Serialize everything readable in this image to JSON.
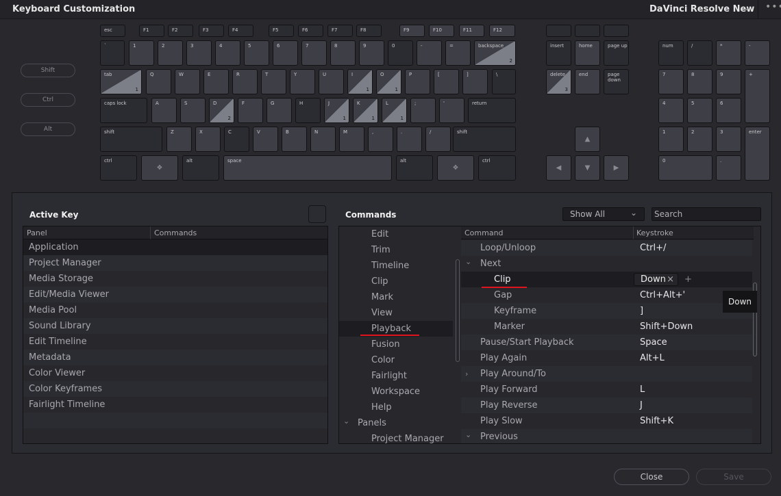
{
  "header": {
    "title": "Keyboard Customization",
    "preset": "DaVinci Resolve New",
    "preset_icon": "chevron-down-icon",
    "more_icon": "ellipsis-icon"
  },
  "modifiers": [
    "Shift",
    "Ctrl",
    "Alt"
  ],
  "keys": [
    {
      "l": "esc",
      "d": 1
    },
    {
      "l": "F1",
      "d": 1
    },
    {
      "l": "F2",
      "d": 1
    },
    {
      "l": "F3",
      "d": 1
    },
    {
      "l": "F4",
      "d": 1
    },
    {
      "l": "F5",
      "d": 1
    },
    {
      "l": "F6",
      "d": 1
    },
    {
      "l": "F7",
      "d": 1
    },
    {
      "l": "F8",
      "d": 1
    },
    {
      "l": "F9"
    },
    {
      "l": "F10"
    },
    {
      "l": "F11"
    },
    {
      "l": "F12"
    },
    {
      "l": "`",
      "d": 1
    },
    {
      "l": "1"
    },
    {
      "l": "2"
    },
    {
      "l": "3"
    },
    {
      "l": "4"
    },
    {
      "l": "5"
    },
    {
      "l": "6"
    },
    {
      "l": "7"
    },
    {
      "l": "8"
    },
    {
      "l": "9"
    },
    {
      "l": "0",
      "d": 1
    },
    {
      "l": "-"
    },
    {
      "l": "="
    },
    {
      "l": "backspace",
      "c": 2
    },
    {
      "l": "tab",
      "c": 1
    },
    {
      "l": "Q"
    },
    {
      "l": "W"
    },
    {
      "l": "E"
    },
    {
      "l": "R"
    },
    {
      "l": "T"
    },
    {
      "l": "Y"
    },
    {
      "l": "U"
    },
    {
      "l": "I",
      "c": 1
    },
    {
      "l": "O",
      "c": 1
    },
    {
      "l": "P"
    },
    {
      "l": "["
    },
    {
      "l": "]"
    },
    {
      "l": "\\",
      "d": 1
    },
    {
      "l": "caps lock",
      "d": 1
    },
    {
      "l": "A"
    },
    {
      "l": "S"
    },
    {
      "l": "D",
      "c": 2
    },
    {
      "l": "F"
    },
    {
      "l": "G"
    },
    {
      "l": "H",
      "d": 1
    },
    {
      "l": "J",
      "c": 1
    },
    {
      "l": "K",
      "c": 1
    },
    {
      "l": "L",
      "c": 1
    },
    {
      "l": ";"
    },
    {
      "l": "'"
    },
    {
      "l": "return",
      "d": 1
    },
    {
      "l": "shift",
      "d": 1
    },
    {
      "l": "Z"
    },
    {
      "l": "X"
    },
    {
      "l": "C",
      "d": 1
    },
    {
      "l": "V"
    },
    {
      "l": "B"
    },
    {
      "l": "N"
    },
    {
      "l": "M"
    },
    {
      "l": ","
    },
    {
      "l": "."
    },
    {
      "l": "/"
    },
    {
      "l": "shift",
      "d": 1
    },
    {
      "l": "ctrl",
      "d": 1
    },
    {
      "l": "",
      "icon": "windows-icon"
    },
    {
      "l": "alt",
      "d": 1
    },
    {
      "l": "space"
    },
    {
      "l": "alt",
      "d": 1
    },
    {
      "l": "",
      "icon": "windows-icon"
    },
    {
      "l": "ctrl",
      "d": 1
    },
    {
      "l": "",
      "d": 1
    },
    {
      "l": "",
      "d": 1
    },
    {
      "l": "",
      "d": 1
    },
    {
      "l": "insert",
      "d": 1
    },
    {
      "l": "home"
    },
    {
      "l": "page up",
      "d": 1
    },
    {
      "l": "delete",
      "c": 3
    },
    {
      "l": "end"
    },
    {
      "l": "page\ndown",
      "d": 1
    },
    {
      "l": "",
      "icon": "arrow-up-icon"
    },
    {
      "l": "",
      "icon": "arrow-left-icon"
    },
    {
      "l": "",
      "icon": "arrow-down-icon"
    },
    {
      "l": "",
      "icon": "arrow-right-icon"
    },
    {
      "l": "num",
      "d": 1
    },
    {
      "l": "/",
      "d": 1
    },
    {
      "l": "*"
    },
    {
      "l": "-"
    },
    {
      "l": "7"
    },
    {
      "l": "8"
    },
    {
      "l": "9"
    },
    {
      "l": "+"
    },
    {
      "l": "4"
    },
    {
      "l": "5"
    },
    {
      "l": "6"
    },
    {
      "l": "1"
    },
    {
      "l": "2"
    },
    {
      "l": "3"
    },
    {
      "l": "enter"
    },
    {
      "l": "0"
    },
    {
      "l": "."
    }
  ],
  "active_key": {
    "title": "Active Key",
    "columns": [
      "Panel",
      "Commands"
    ],
    "rows": [
      "Application",
      "Project Manager",
      "Media Storage",
      "Edit/Media Viewer",
      "Media Pool",
      "Sound Library",
      "Edit Timeline",
      "Metadata",
      "Color Viewer",
      "Color Keyframes",
      "Fairlight Timeline"
    ],
    "selected": 0
  },
  "commands": {
    "title": "Commands",
    "filter": "Show All",
    "search_placeholder": "Search",
    "tree": [
      {
        "t": "Edit",
        "i": 1
      },
      {
        "t": "Trim",
        "i": 1
      },
      {
        "t": "Timeline",
        "i": 1
      },
      {
        "t": "Clip",
        "i": 1
      },
      {
        "t": "Mark",
        "i": 1
      },
      {
        "t": "View",
        "i": 1
      },
      {
        "t": "Playback",
        "i": 1,
        "sel": 1
      },
      {
        "t": "Fusion",
        "i": 1
      },
      {
        "t": "Color",
        "i": 1
      },
      {
        "t": "Fairlight",
        "i": 1
      },
      {
        "t": "Workspace",
        "i": 1
      },
      {
        "t": "Help",
        "i": 1
      },
      {
        "t": "Panels",
        "i": 0,
        "exp": "v"
      },
      {
        "t": "Project Manager",
        "i": 1
      }
    ],
    "columns": [
      "Command",
      "Keystroke"
    ],
    "rows": [
      {
        "c": "Loop/Unloop",
        "k": "Ctrl+/",
        "i": 1
      },
      {
        "c": "Next",
        "k": "",
        "i": 1,
        "exp": "v"
      },
      {
        "c": "Clip",
        "k": "Down",
        "i": 2,
        "sel": 1
      },
      {
        "c": "Gap",
        "k": "Ctrl+Alt+'",
        "i": 2
      },
      {
        "c": "Keyframe",
        "k": "]",
        "i": 2
      },
      {
        "c": "Marker",
        "k": "Shift+Down",
        "i": 2
      },
      {
        "c": "Pause/Start Playback",
        "k": "Space",
        "i": 1
      },
      {
        "c": "Play Again",
        "k": "Alt+L",
        "i": 1
      },
      {
        "c": "Play Around/To",
        "k": "",
        "i": 1,
        "exp": ">"
      },
      {
        "c": "Play Forward",
        "k": "L",
        "i": 1
      },
      {
        "c": "Play Reverse",
        "k": "J",
        "i": 1
      },
      {
        "c": "Play Slow",
        "k": "Shift+K",
        "i": 1
      },
      {
        "c": "Previous",
        "k": "",
        "i": 1,
        "exp": "v"
      }
    ],
    "tooltip": "Down",
    "remove_icon": "close-icon",
    "add_icon": "plus-icon"
  },
  "footer": {
    "close": "Close",
    "save": "Save"
  },
  "colors": {
    "highlight_underline": "#e0141e",
    "assigned_key": "#3e3f46",
    "unassigned_key": "#2b2c31",
    "assigned_triangle": "#7d7f88"
  }
}
